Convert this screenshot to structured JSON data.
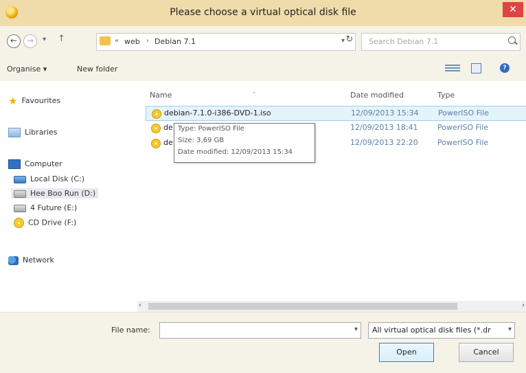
{
  "window": {
    "title": "Please choose a virtual optical disk file",
    "close_label": "✕"
  },
  "nav": {
    "back": "←",
    "forward": "→",
    "dropdown": "▾",
    "up": "↑"
  },
  "address": {
    "overflow": "«",
    "crumbs": [
      "web",
      "Debian 7.1"
    ],
    "sep": "›",
    "dropdown": "▾",
    "refresh": "↻"
  },
  "search": {
    "placeholder": "Search Debian 7.1"
  },
  "toolbar": {
    "organise": "Organise ▾",
    "new_folder": "New folder",
    "help": "?"
  },
  "sidebar": {
    "favourites": "Favourites",
    "libraries": "Libraries",
    "computer": "Computer",
    "drives": [
      "Local Disk (C:)",
      "Hee Boo Run (D:)",
      "4 Future (E:)",
      "CD Drive (F:)"
    ],
    "network": "Network"
  },
  "columns": {
    "name": "Name",
    "date": "Date modified",
    "type": "Type",
    "sort_indicator": "˄"
  },
  "files": [
    {
      "name": "debian-7.1.0-i386-DVD-1.iso",
      "date": "12/09/2013 15:34",
      "type": "PowerISO File"
    },
    {
      "name": "de",
      "date": "12/09/2013 18:41",
      "type": "PowerISO File"
    },
    {
      "name": "de",
      "date": "12/09/2013 22:20",
      "type": "PowerISO File"
    }
  ],
  "tooltip": {
    "type": "Type: PowerISO File",
    "size": "Size: 3,69 GB",
    "date": "Date modified: 12/09/2013 15:34"
  },
  "scroll": {
    "left": "‹",
    "right": "›"
  },
  "bottom": {
    "file_name_label": "File name:",
    "file_name_value": "",
    "file_type": "All virtual optical disk files (*.dr",
    "open": "Open",
    "cancel": "Cancel",
    "caret": "▾"
  },
  "colors": {
    "titlebar": "#efdcaa",
    "close": "#e04343",
    "selection": "#e5f3fb",
    "accent": "#2f6cc2"
  }
}
